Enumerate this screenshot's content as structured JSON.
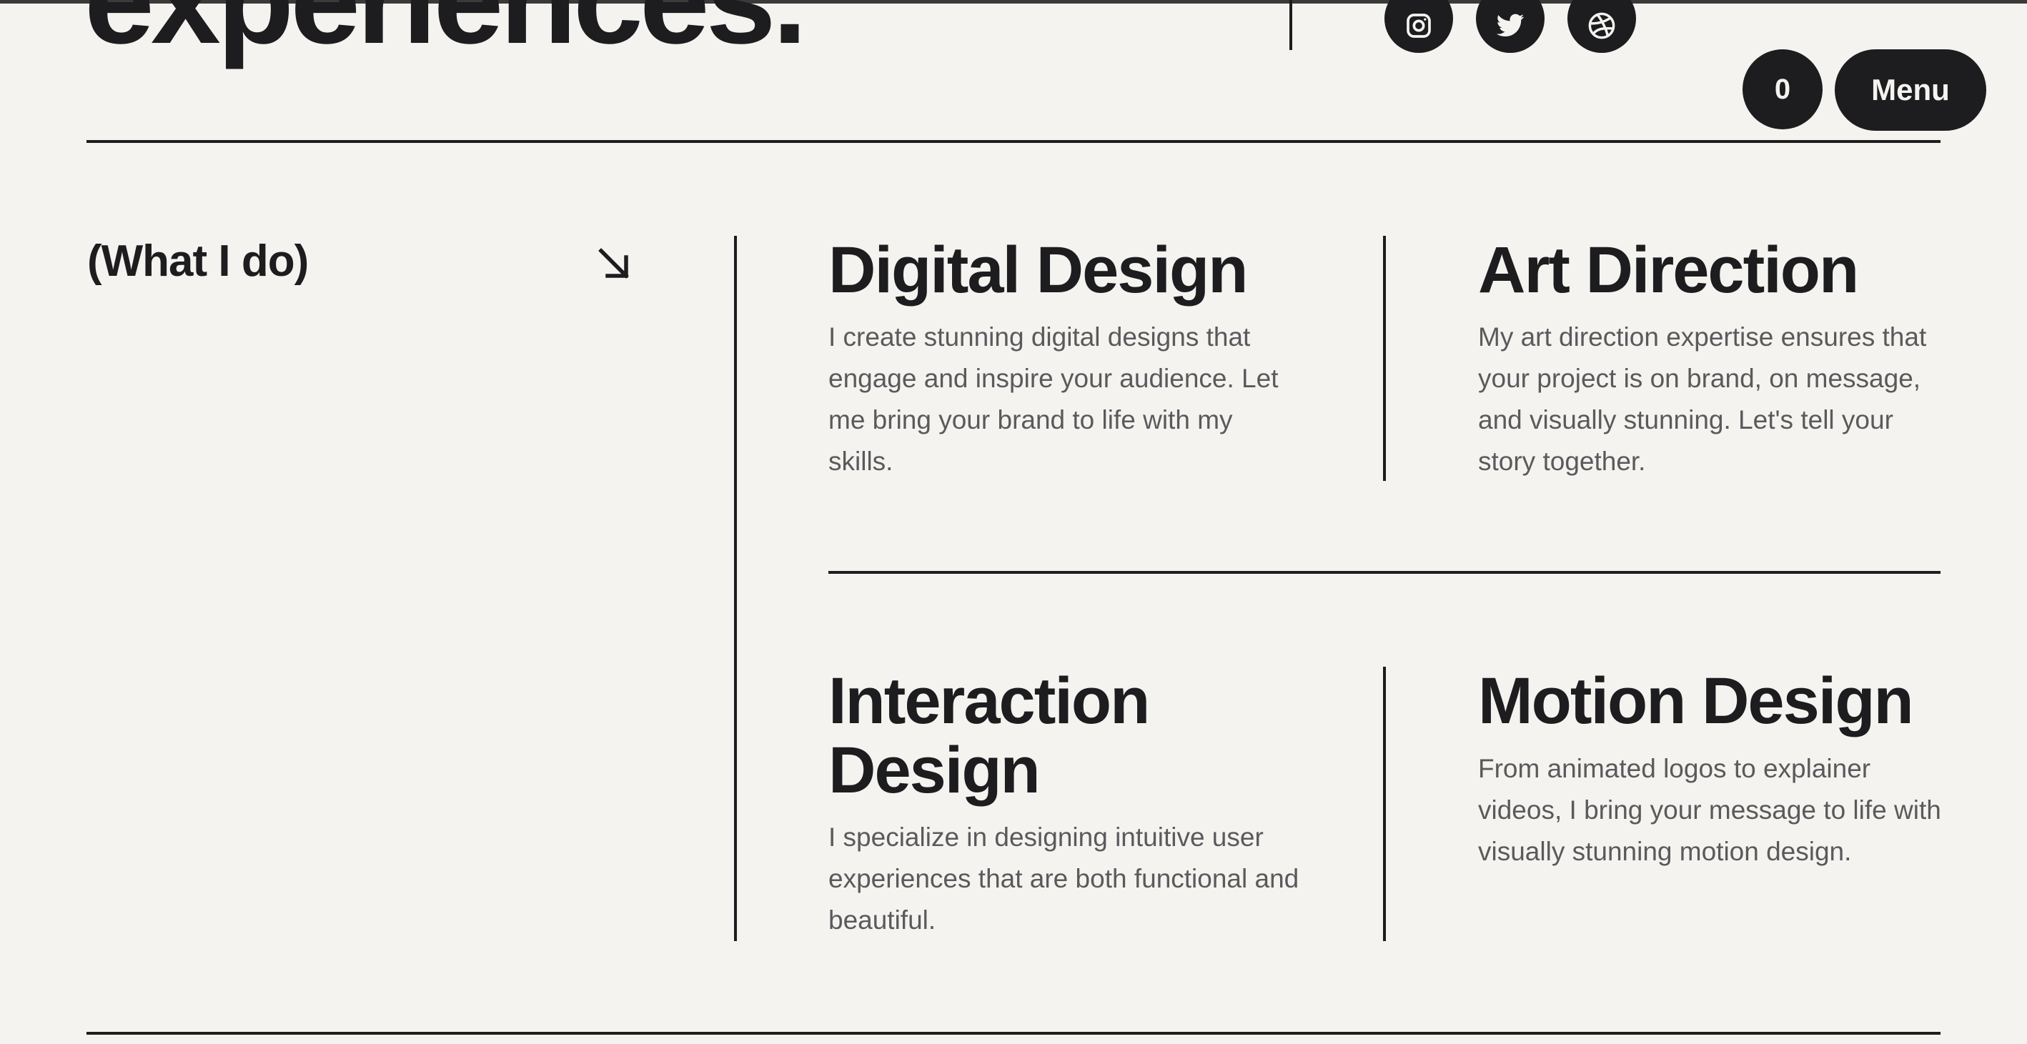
{
  "hero": {
    "heading": "experiences."
  },
  "social": [
    {
      "icon": "instagram-icon"
    },
    {
      "icon": "twitter-icon"
    },
    {
      "icon": "dribbble-icon"
    }
  ],
  "header": {
    "cart_count": "0",
    "menu_label": "Menu"
  },
  "section": {
    "label": "(What I do)",
    "arrow_icon": "arrow-down-right-icon"
  },
  "services": [
    {
      "title": "Digital Design",
      "description": "I create stunning digital designs that engage and inspire your audience. Let me bring your brand to life with my skills."
    },
    {
      "title": "Art Direction",
      "description": "My art direction expertise ensures that your project is on brand, on message, and visually stunning. Let's tell your story together."
    },
    {
      "title": "Interaction Design",
      "description": "I specialize in designing intuitive user experiences that are both functional and beautiful."
    },
    {
      "title": "Motion Design",
      "description": "From animated logos to explainer videos, I bring your message to life with visually stunning motion design."
    }
  ],
  "colors": {
    "background": "#f4f3f0",
    "ink": "#1d1d1f",
    "muted_text": "#5a5a5c"
  }
}
